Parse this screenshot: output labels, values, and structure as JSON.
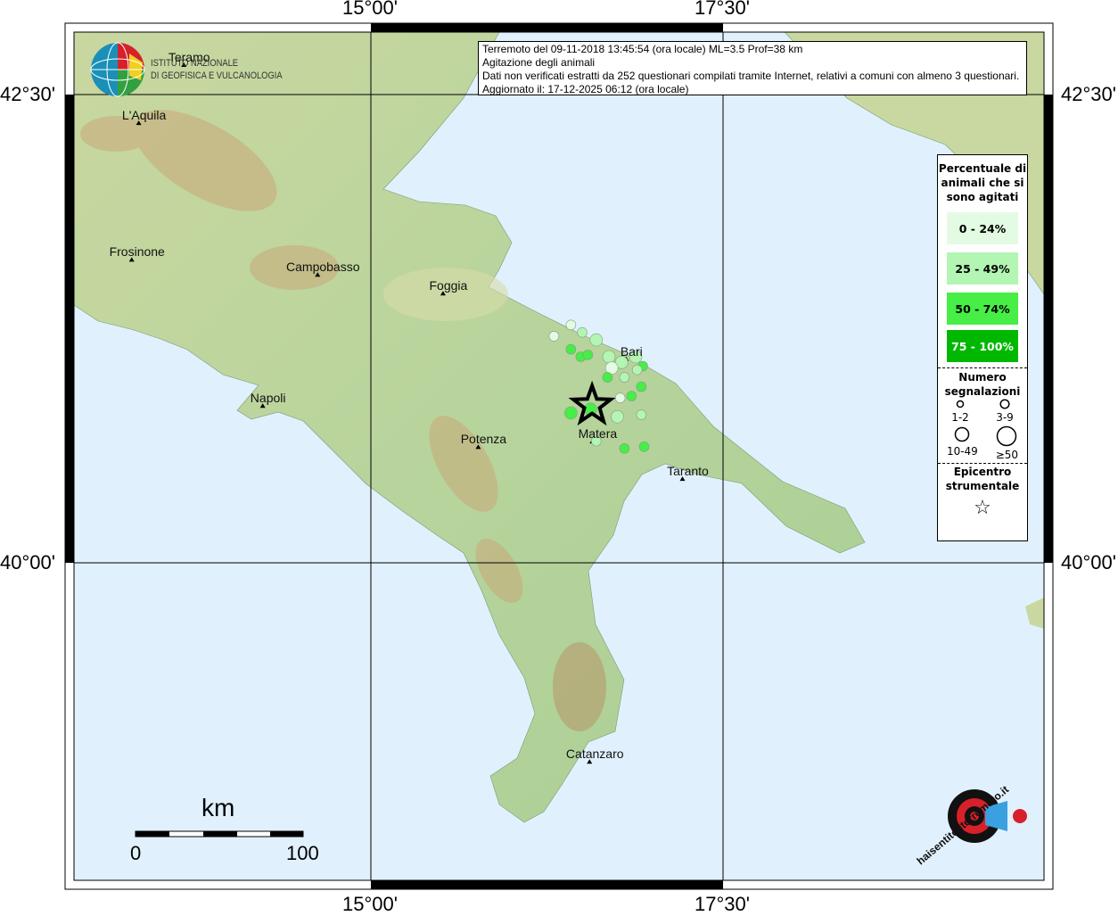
{
  "info_box": {
    "line1": "Terremoto del 09-11-2018 13:45:54 (ora locale) ML=3.5 Prof=38 km",
    "line2": "Agitazione degli animali",
    "line3": "Dati non verificati estratti da 252 questionari compilati tramite Internet, relativi a comuni con almeno 3 questionari.",
    "line4": "Aggiornato il: 17-12-2025 06:12 (ora locale)"
  },
  "axes": {
    "lon_ticks": [
      "15°00'",
      "17°30'"
    ],
    "lat_ticks": [
      "42°30'",
      "40°00'"
    ]
  },
  "logo_ingv": {
    "line1": "ISTITUTO NAZIONALE",
    "line2": "DI GEOFISICA E VULCANOLOGIA"
  },
  "logo_hsit": {
    "text": "haisentitoilterremoto.it",
    "sub": "www."
  },
  "scale_bar": {
    "unit": "km",
    "min": "0",
    "max": "100"
  },
  "colors": {
    "sea": "#e0f1fd",
    "p0_24": "#e3fbe3",
    "p25_49": "#b3f5b3",
    "p50_74": "#46ee46",
    "p75_100": "#00b800"
  },
  "legend": {
    "title": "Percentuale di animali che si sono agitati",
    "classes": [
      "0 - 24%",
      "25 - 49%",
      "50 - 74%",
      "75 - 100%"
    ],
    "count_title": "Numero segnalazioni",
    "counts": [
      "1-2",
      "3-9",
      "10-49",
      "≥50"
    ],
    "epicenter_title": "Epicentro strumentale"
  },
  "cities": [
    {
      "name": "Teramo",
      "lon": 13.71,
      "lat": 42.7
    },
    {
      "name": "L'Aquila",
      "lon": 13.39,
      "lat": 42.39
    },
    {
      "name": "Frosinone",
      "lon": 13.34,
      "lat": 41.66
    },
    {
      "name": "Campobasso",
      "lon": 14.66,
      "lat": 41.58
    },
    {
      "name": "Foggia",
      "lon": 15.55,
      "lat": 41.48
    },
    {
      "name": "Napoli",
      "lon": 14.27,
      "lat": 40.88
    },
    {
      "name": "Potenza",
      "lon": 15.8,
      "lat": 40.66
    },
    {
      "name": "Bari",
      "lon": 16.85,
      "lat": 41.13
    },
    {
      "name": "Matera",
      "lon": 16.61,
      "lat": 40.69
    },
    {
      "name": "Taranto",
      "lon": 17.25,
      "lat": 40.49
    },
    {
      "name": "Catanzaro",
      "lon": 16.59,
      "lat": 38.98
    }
  ],
  "epicenter": {
    "lon": 16.57,
    "lat": 40.84
  },
  "observations": [
    {
      "lon": 16.42,
      "lat": 41.27,
      "pct": "0 - 24%",
      "count": "3-9"
    },
    {
      "lon": 16.3,
      "lat": 41.21,
      "pct": "0 - 24%",
      "count": "3-9"
    },
    {
      "lon": 16.5,
      "lat": 41.23,
      "pct": "25 - 49%",
      "count": "3-9"
    },
    {
      "lon": 16.6,
      "lat": 41.19,
      "pct": "25 - 49%",
      "count": "10-49"
    },
    {
      "lon": 16.42,
      "lat": 41.14,
      "pct": "50 - 74%",
      "count": "3-9"
    },
    {
      "lon": 16.49,
      "lat": 41.1,
      "pct": "50 - 74%",
      "count": "3-9"
    },
    {
      "lon": 16.54,
      "lat": 41.11,
      "pct": "50 - 74%",
      "count": "3-9"
    },
    {
      "lon": 16.69,
      "lat": 41.1,
      "pct": "25 - 49%",
      "count": "10-49"
    },
    {
      "lon": 16.78,
      "lat": 41.07,
      "pct": "25 - 49%",
      "count": "10-49"
    },
    {
      "lon": 16.88,
      "lat": 41.1,
      "pct": "25 - 49%",
      "count": "10-49"
    },
    {
      "lon": 16.71,
      "lat": 41.04,
      "pct": "0 - 24%",
      "count": "10-49"
    },
    {
      "lon": 16.93,
      "lat": 41.05,
      "pct": "50 - 74%",
      "count": "3-9"
    },
    {
      "lon": 16.89,
      "lat": 41.03,
      "pct": "25 - 49%",
      "count": "3-9"
    },
    {
      "lon": 16.68,
      "lat": 40.99,
      "pct": "50 - 74%",
      "count": "3-9"
    },
    {
      "lon": 16.8,
      "lat": 40.99,
      "pct": "25 - 49%",
      "count": "3-9"
    },
    {
      "lon": 16.92,
      "lat": 40.94,
      "pct": "50 - 74%",
      "count": "3-9"
    },
    {
      "lon": 16.77,
      "lat": 40.88,
      "pct": "0 - 24%",
      "count": "3-9"
    },
    {
      "lon": 16.85,
      "lat": 40.89,
      "pct": "50 - 74%",
      "count": "3-9"
    },
    {
      "lon": 16.42,
      "lat": 40.8,
      "pct": "50 - 74%",
      "count": "10-49"
    },
    {
      "lon": 16.56,
      "lat": 40.82,
      "pct": "50 - 74%",
      "count": "10-49"
    },
    {
      "lon": 16.75,
      "lat": 40.78,
      "pct": "25 - 49%",
      "count": "10-49"
    },
    {
      "lon": 16.92,
      "lat": 40.79,
      "pct": "25 - 49%",
      "count": "3-9"
    },
    {
      "lon": 16.6,
      "lat": 40.65,
      "pct": "25 - 49%",
      "count": "3-9"
    },
    {
      "lon": 16.8,
      "lat": 40.61,
      "pct": "50 - 74%",
      "count": "3-9"
    },
    {
      "lon": 16.94,
      "lat": 40.62,
      "pct": "50 - 74%",
      "count": "3-9"
    }
  ]
}
